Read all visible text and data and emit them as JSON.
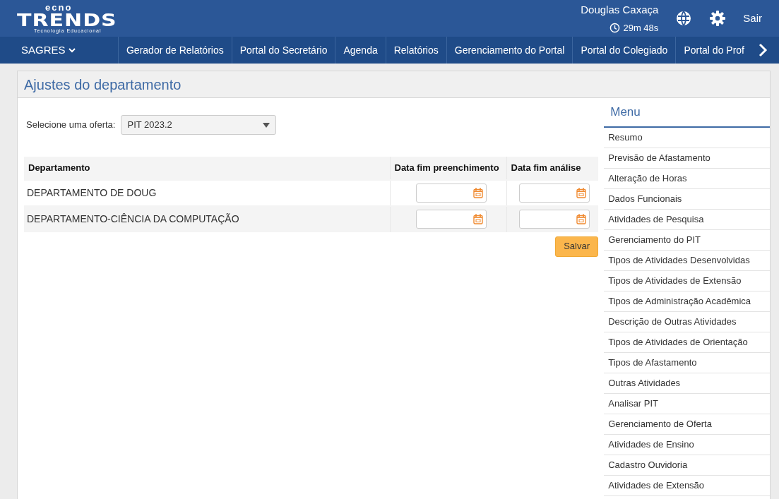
{
  "logo": {
    "top": "ecno",
    "main": "TRENDS",
    "tagline": "Tecnologia Educacional"
  },
  "user": {
    "name": "Douglas Caxaça",
    "timer": "29m 48s",
    "logout": "Sair"
  },
  "nav": {
    "brand": "SAGRES",
    "items": [
      "Gerador de Relatórios",
      "Portal do Secretário",
      "Agenda",
      "Relatórios",
      "Gerenciamento do Portal",
      "Portal do Colegiado",
      "Portal do Prof"
    ]
  },
  "page": {
    "title": "Ajustes do departamento"
  },
  "offer": {
    "label": "Selecione uma oferta:",
    "value": "PIT 2023.2"
  },
  "table": {
    "columns": [
      "Departamento",
      "Data fim preenchimento",
      "Data fim análise"
    ],
    "rows": [
      {
        "department": "DEPARTAMENTO DE DOUG"
      },
      {
        "department": "DEPARTAMENTO-CIÊNCIA DA COMPUTAÇÃO"
      }
    ]
  },
  "save_button": "Salvar",
  "menu": {
    "title": "Menu",
    "items": [
      "Resumo",
      "Previsão de Afastamento",
      "Alteração de Horas",
      "Dados Funcionais",
      "Atividades de Pesquisa",
      "Gerenciamento do PIT",
      "Tipos de Atividades Desenvolvidas",
      "Tipos de Atividades de Extensão",
      "Tipos de Administração Acadêmica",
      "Descrição de Outras Atividades",
      "Tipos de Atividades de Orientação",
      "Tipos de Afastamento",
      "Outras Atividades",
      "Analisar PIT",
      "Gerenciamento de Oferta",
      "Atividades de Ensino",
      "Cadastro Ouvidoria",
      "Atividades de Extensão"
    ]
  }
}
